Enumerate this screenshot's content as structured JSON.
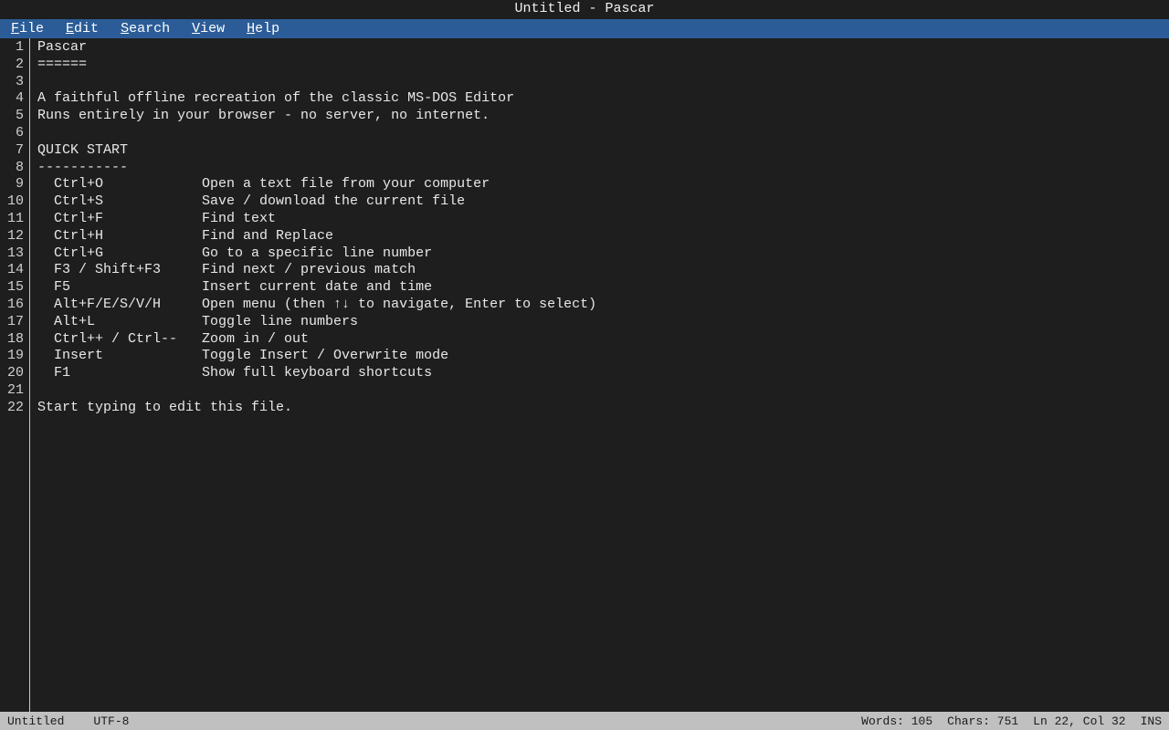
{
  "window": {
    "title": "Untitled - Pascar"
  },
  "menu": {
    "items": [
      {
        "accel": "F",
        "rest": "ile"
      },
      {
        "accel": "E",
        "rest": "dit"
      },
      {
        "accel": "S",
        "rest": "earch"
      },
      {
        "accel": "V",
        "rest": "iew"
      },
      {
        "accel": "H",
        "rest": "elp"
      }
    ]
  },
  "editor": {
    "line_numbers": [
      "1",
      "2",
      "3",
      "4",
      "5",
      "6",
      "7",
      "8",
      "9",
      "10",
      "11",
      "12",
      "13",
      "14",
      "15",
      "16",
      "17",
      "18",
      "19",
      "20",
      "21",
      "22"
    ],
    "lines": [
      "Pascar",
      "======",
      "",
      "A faithful offline recreation of the classic MS-DOS Editor",
      "Runs entirely in your browser - no server, no internet.",
      "",
      "QUICK START",
      "-----------",
      "  Ctrl+O            Open a text file from your computer",
      "  Ctrl+S            Save / download the current file",
      "  Ctrl+F            Find text",
      "  Ctrl+H            Find and Replace",
      "  Ctrl+G            Go to a specific line number",
      "  F3 / Shift+F3     Find next / previous match",
      "  F5                Insert current date and time",
      "  Alt+F/E/S/V/H     Open menu (then ↑↓ to navigate, Enter to select)",
      "  Alt+L             Toggle line numbers",
      "  Ctrl++ / Ctrl--   Zoom in / out",
      "  Insert            Toggle Insert / Overwrite mode",
      "  F1                Show full keyboard shortcuts",
      "",
      "Start typing to edit this file."
    ]
  },
  "status": {
    "filename": "Untitled",
    "encoding": "UTF-8",
    "words": "Words: 105",
    "chars": "Chars: 751",
    "position": "Ln 22, Col 32",
    "mode": "INS"
  },
  "colors": {
    "menubar": "#2b5c97",
    "background": "#1e1e1e",
    "statusbar": "#c0c0c0"
  }
}
